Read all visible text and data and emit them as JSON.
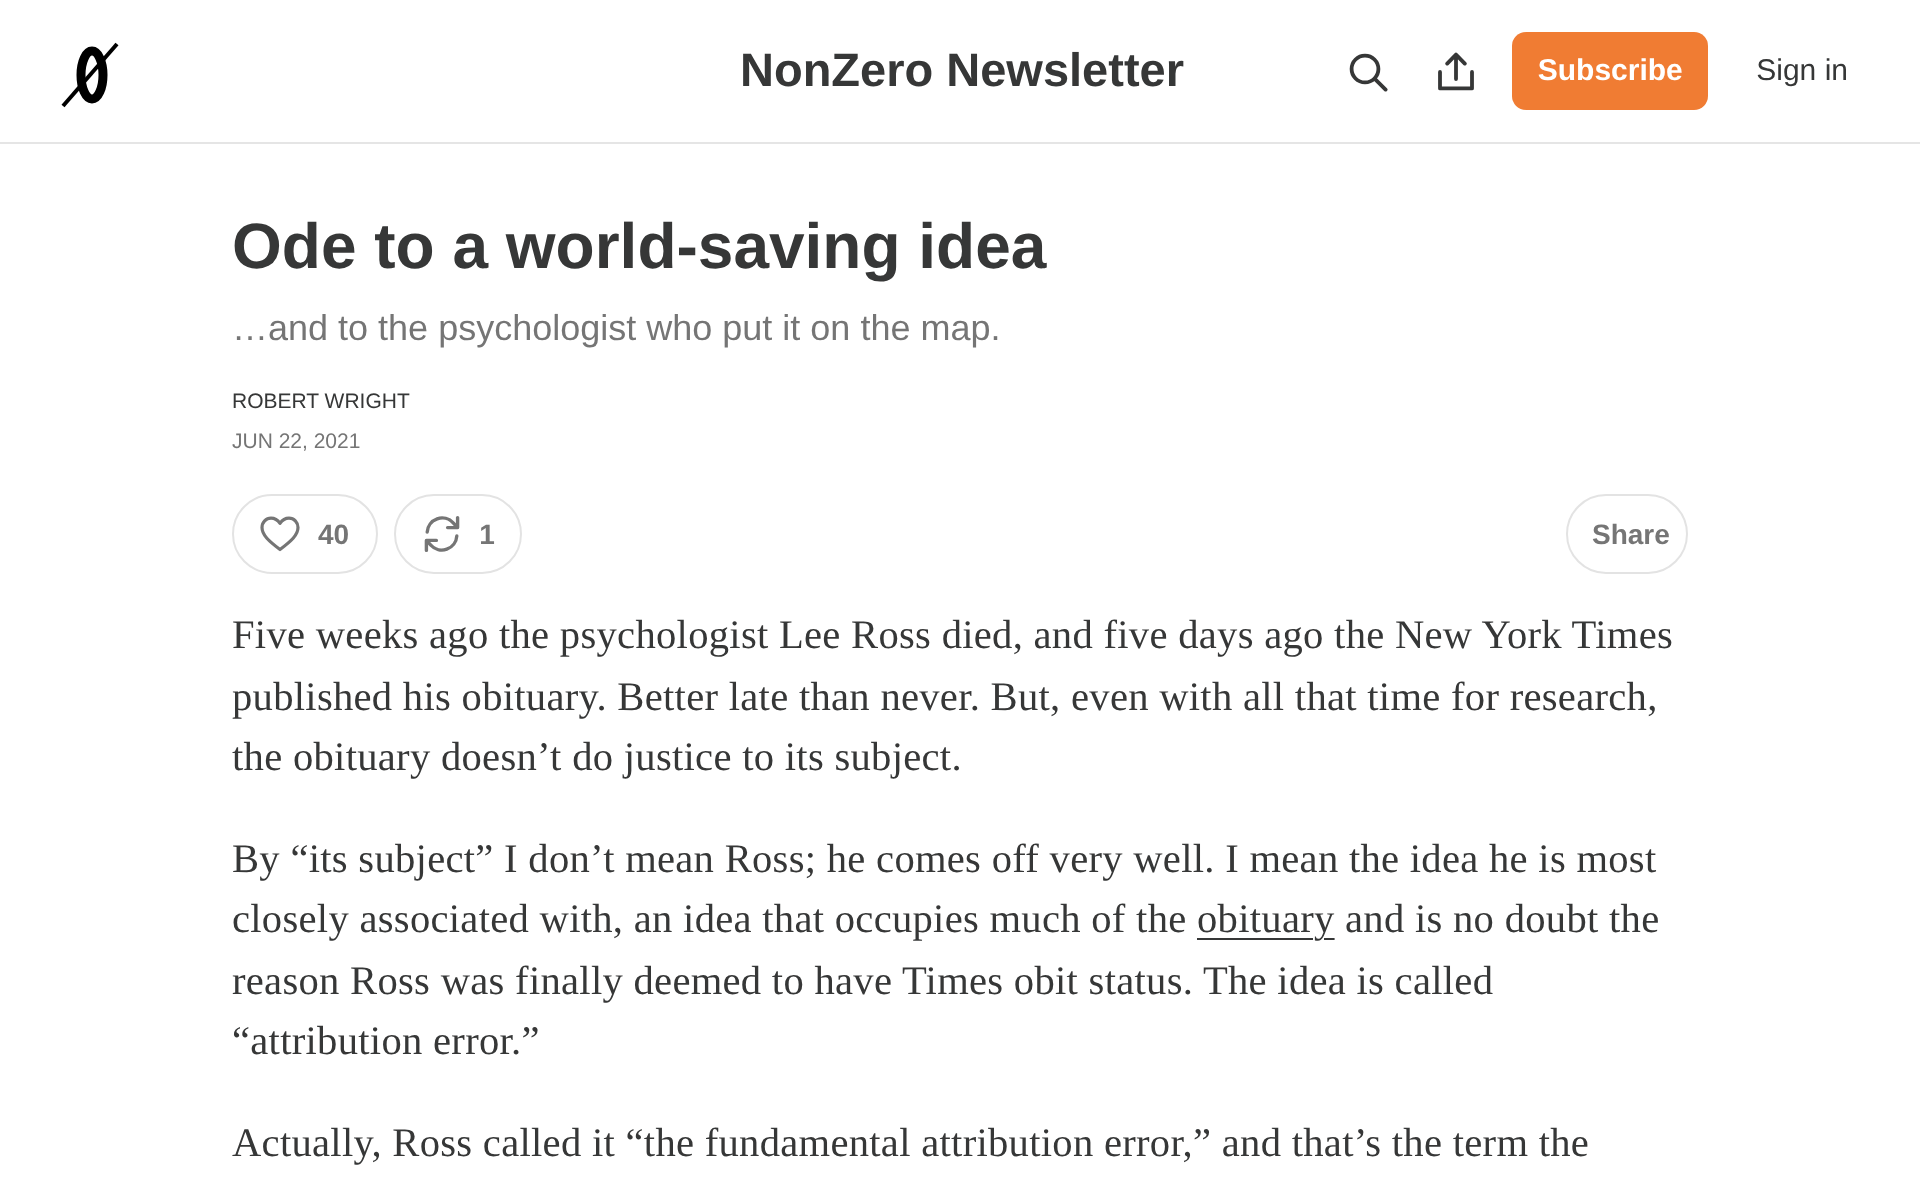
{
  "header": {
    "publication_title": "NonZero Newsletter",
    "subscribe_button": "Subscribe",
    "sign_in_link": "Sign in"
  },
  "post": {
    "title": "Ode to a world-saving idea",
    "subtitle": "…and to the psychologist who put it on the map.",
    "author": "ROBERT WRIGHT",
    "date": "JUN 22, 2021",
    "actions": [
      {
        "kind": "like",
        "count": "40"
      },
      {
        "kind": "restack",
        "count": "1"
      }
    ],
    "share_button": "Share",
    "paragraphs": [
      {
        "parts": [
          {
            "kind": "text",
            "text": "Five weeks ago the psychologist Lee Ross died, and five days ago the New York Times published his obituary. Better late than never. But, even with all that time for research, the obituary doesn’t do justice to its subject."
          }
        ]
      },
      {
        "parts": [
          {
            "kind": "text",
            "text": "By “its subject” I don’t mean Ross; he comes off very well. I mean the idea he is most closely associated with, an idea that occupies much of the "
          },
          {
            "kind": "link",
            "text": "obituary"
          },
          {
            "kind": "text",
            "text": " and is no doubt the reason Ross was finally deemed to have Times obit status. The idea is called “attribution error.”"
          }
        ]
      },
      {
        "parts": [
          {
            "kind": "text",
            "text": "Actually, Ross called it “the fundamental attribution error,” and that’s the term the"
          }
        ]
      }
    ]
  }
}
